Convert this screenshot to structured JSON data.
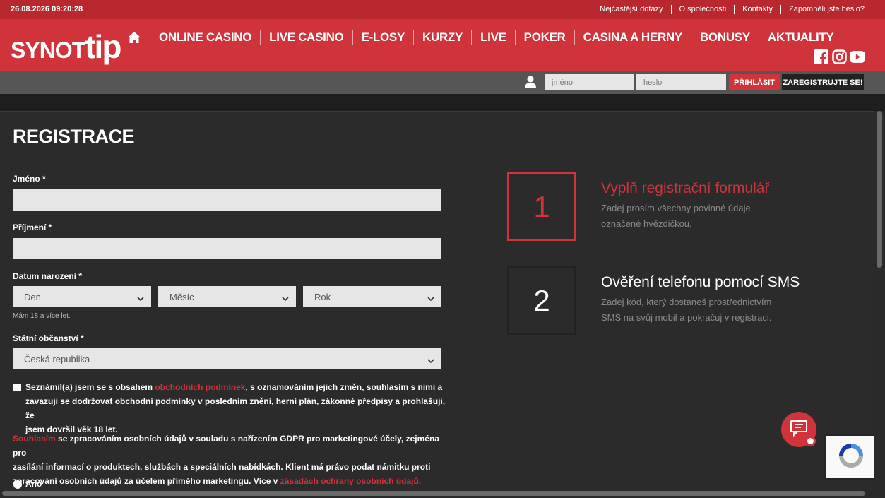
{
  "topbar": {
    "datetime": "26.08.2026 09:20:28",
    "links": [
      "Nejčastější dotazy",
      "O společnosti",
      "Kontakty",
      "Zapomněli jste heslo?"
    ]
  },
  "header": {
    "logo_part1": "SYNOT",
    "logo_part2": "tip",
    "nav": [
      "ONLINE CASINO",
      "LIVE CASINO",
      "E-LOSY",
      "KURZY",
      "LIVE",
      "POKER",
      "CASINA A HERNY",
      "BONUSY",
      "AKTUALITY"
    ],
    "icons": [
      "home-icon",
      "facebook-icon",
      "instagram-icon",
      "youtube-icon"
    ]
  },
  "login": {
    "username_placeholder": "jméno",
    "password_placeholder": "heslo",
    "login_label": "PŘIHLÁSIT",
    "register_label": "ZAREGISTRUJTE SE!"
  },
  "form": {
    "title": "REGISTRACE",
    "first_name_label": "Jméno *",
    "last_name_label": "Příjmení *",
    "dob_label": "Datum narození *",
    "day": "Den",
    "month": "Měsíc",
    "year": "Rok",
    "age_hint": "Mám 18 a více let.",
    "citizenship_label": "Státní občanství *",
    "citizenship_value": "Česká republika",
    "terms_pre": "Seznámil(a) jsem se s obsahem ",
    "terms_link": "obchodních podmínek",
    "terms_line1_post": ", s oznamováním jejich změn, souhlasím s nimi a",
    "terms_line2": "zavazuji se dodržovat obchodní podmínky v posledním znění, herní plán, zákonné předpisy a prohlašuji, že",
    "terms_line3": "jsem dovršil věk 18 let.",
    "gdpr_link": "Souhlasím",
    "gdpr_line1_post": " se zpracováním osobních údajů v souladu s nařízením GDPR pro marketingové účely, zejména pro",
    "gdpr_line2": "zasílání informací o produktech, službách a speciálních nabídkách. Klient má právo podat námitku proti",
    "gdpr_line3_pre": "zpracování osobních údajů za účelem přímého marketingu. Více v ",
    "gdpr_link2": "zásadách ochrany osobních údajů.",
    "yes_label": "Ano"
  },
  "steps": [
    {
      "number": "1",
      "title": "Vyplň registrační formulář",
      "desc1": "Zadej prosím všechny povinné údaje",
      "desc2": "označené hvězdičkou."
    },
    {
      "number": "2",
      "title": "Ověření telefonu pomocí SMS",
      "desc1": "Zadej kód, který dostaneš prostřednictvím",
      "desc2": "SMS na svůj mobil a pokračuj v registraci."
    }
  ],
  "colors": {
    "brand_red": "#d0333a",
    "dark_red": "#b9282f",
    "background": "#2b2b2b"
  }
}
